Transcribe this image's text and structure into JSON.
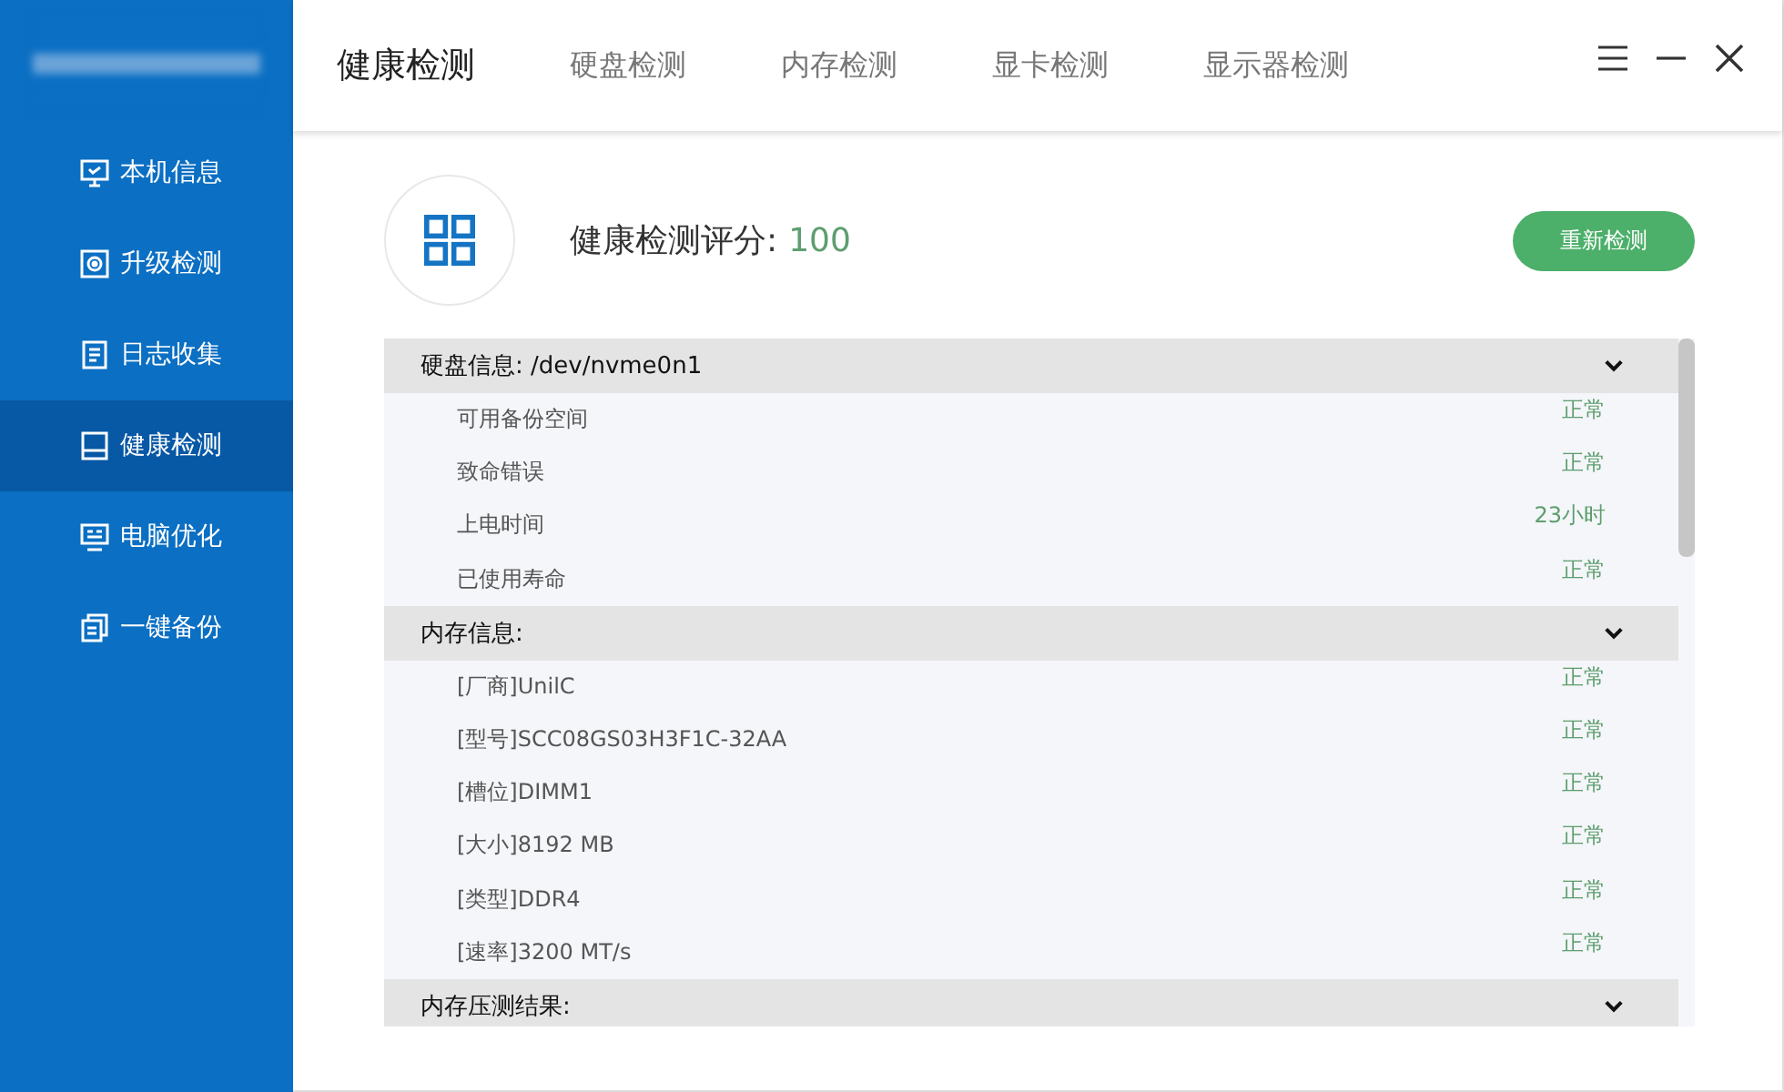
{
  "sidebar": {
    "items": [
      {
        "label": "本机信息",
        "kind": "monitor",
        "selected": false
      },
      {
        "label": "升级检测",
        "kind": "disc",
        "selected": false
      },
      {
        "label": "日志收集",
        "kind": "document",
        "selected": false
      },
      {
        "label": "健康检测",
        "kind": "drive",
        "selected": true
      },
      {
        "label": "电脑优化",
        "kind": "screen",
        "selected": false
      },
      {
        "label": "一键备份",
        "kind": "copy",
        "selected": false
      }
    ]
  },
  "tabs": [
    {
      "label": "健康检测",
      "selected": true
    },
    {
      "label": "硬盘检测",
      "selected": false
    },
    {
      "label": "内存检测",
      "selected": false
    },
    {
      "label": "显卡检测",
      "selected": false
    },
    {
      "label": "显示器检测",
      "selected": false
    }
  ],
  "score": {
    "label": "健康检测评分:",
    "value": "100"
  },
  "recheck_button": "重新检测",
  "sections": [
    {
      "title": "硬盘信息: /dev/nvme0n1",
      "items": [
        {
          "name": "可用备份空间",
          "status": "正常"
        },
        {
          "name": "致命错误",
          "status": "正常"
        },
        {
          "name": "上电时间",
          "status": "23小时"
        },
        {
          "name": "已使用寿命",
          "status": "正常"
        }
      ]
    },
    {
      "title": "内存信息:",
      "items": [
        {
          "name": "[厂商]UnilC",
          "status": "正常"
        },
        {
          "name": "[型号]SCC08GS03H3F1C-32AA",
          "status": "正常"
        },
        {
          "name": "[槽位]DIMM1",
          "status": "正常"
        },
        {
          "name": "[大小]8192 MB",
          "status": "正常"
        },
        {
          "name": "[类型]DDR4",
          "status": "正常"
        },
        {
          "name": "[速率]3200 MT/s",
          "status": "正常"
        }
      ]
    },
    {
      "title": "内存压测结果:"
    }
  ]
}
